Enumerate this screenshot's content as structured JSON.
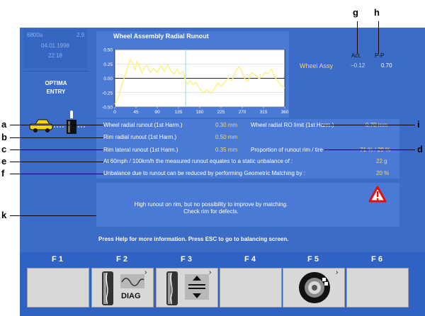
{
  "header": {
    "code": "6800a",
    "version": "2.9",
    "date": "04.01.1998",
    "time": "22:18",
    "mode_line1": "OPTIMA",
    "mode_line2": "ENTRY"
  },
  "chart_data": {
    "type": "line",
    "title": "Wheel Assembly Radial Runout",
    "xlabel": "",
    "ylabel": "",
    "xlim": [
      0,
      360
    ],
    "ylim": [
      -0.5,
      0.5
    ],
    "xticks": [
      "0",
      "45",
      "90",
      "135",
      "180",
      "225",
      "270",
      "315",
      "360"
    ],
    "yticks": [
      "0.50",
      "0.25",
      "0.00",
      "-0.25",
      "-0.50"
    ],
    "marker_x": 150,
    "series": [
      {
        "values": [
          [
            0,
            -0.45
          ],
          [
            8,
            -0.33
          ],
          [
            15,
            -0.12
          ],
          [
            22,
            0.05
          ],
          [
            28,
            0.22
          ],
          [
            33,
            0.33
          ],
          [
            38,
            0.26
          ],
          [
            43,
            0.14
          ],
          [
            47,
            0.3
          ],
          [
            52,
            0.22
          ],
          [
            58,
            0.08
          ],
          [
            63,
            0.2
          ],
          [
            68,
            0.23
          ],
          [
            75,
            0.1
          ],
          [
            82,
            0.17
          ],
          [
            90,
            0.1
          ],
          [
            98,
            0.22
          ],
          [
            105,
            0.12
          ],
          [
            112,
            0.24
          ],
          [
            118,
            0.14
          ],
          [
            125,
            0.07
          ],
          [
            132,
            0.16
          ],
          [
            138,
            0.07
          ],
          [
            145,
            0.12
          ],
          [
            150,
            -0.05
          ],
          [
            155,
            -0.1
          ],
          [
            160,
            -0.04
          ],
          [
            165,
            -0.12
          ],
          [
            172,
            -0.07
          ],
          [
            180,
            -0.18
          ],
          [
            188,
            -0.25
          ],
          [
            195,
            -0.2
          ],
          [
            202,
            -0.26
          ],
          [
            210,
            -0.2
          ],
          [
            218,
            -0.08
          ],
          [
            225,
            -0.14
          ],
          [
            232,
            -0.07
          ],
          [
            240,
            0.0
          ],
          [
            248,
            -0.04
          ],
          [
            255,
            0.1
          ],
          [
            262,
            0.2
          ],
          [
            268,
            0.14
          ],
          [
            275,
            0.0
          ],
          [
            282,
            -0.05
          ],
          [
            290,
            0.1
          ],
          [
            297,
            0.06
          ],
          [
            305,
            0.0
          ],
          [
            312,
            0.02
          ],
          [
            318,
            0.1
          ],
          [
            325,
            0.08
          ],
          [
            332,
            0.16
          ],
          [
            338,
            0.04
          ],
          [
            345,
            -0.05
          ],
          [
            352,
            -0.12
          ],
          [
            360,
            -0.17
          ]
        ]
      }
    ]
  },
  "readout": {
    "label": "Wheel Assy",
    "act_header": "Act.",
    "pp_header": "P-P",
    "act_value": "−0.12",
    "pp_value": "0.70"
  },
  "measurements": {
    "wheel_radial_runout_label": "Wheel radial runout (1st Harm.)",
    "wheel_radial_runout_value": "0.30 mm",
    "wheel_radial_limit_label": "Wheel radial RO limit (1st Harm.)",
    "wheel_radial_limit_value": "0.70 mm",
    "rim_radial_label": "Rim radial runout (1st Harm.)",
    "rim_radial_value": "0.50 mm",
    "rim_lateral_label": "Rim lateral runout (1st Harm.)",
    "rim_lateral_value": "0.35 mm",
    "proportion_label": "Proportion of runout rim / tire",
    "proportion_value": "71 % / 29 %",
    "static_unbalance_label": "At 60mph / 100km/h the measured runout equates to a static unbalance of :",
    "static_unbalance_value": "22 g",
    "matching_label": "Unbalance due to runout can be reduced by performing Geometric Matching by :",
    "matching_value": "20 %"
  },
  "message": {
    "line1": "High runout on rim, but no possibility to improve by matching.",
    "line2": "Check rim for defects.",
    "help": "Press Help for more information. Press ESC to go to balancing screen."
  },
  "fkeys": [
    {
      "label": "F 1"
    },
    {
      "label": "F 2",
      "caption": "DIAG"
    },
    {
      "label": "F 3"
    },
    {
      "label": "F 4"
    },
    {
      "label": "F 5"
    },
    {
      "label": "F 6"
    }
  ],
  "callouts": [
    "a",
    "b",
    "c",
    "d",
    "e",
    "f",
    "g",
    "h",
    "i",
    "k"
  ],
  "colors": {
    "screen_bg": "#3c6cc8",
    "panel_bg": "#4a7ad6",
    "trace": "#fff07a",
    "marker": "#7fe0e8",
    "value_text": "#f0d77a",
    "warning": "#e01010"
  }
}
